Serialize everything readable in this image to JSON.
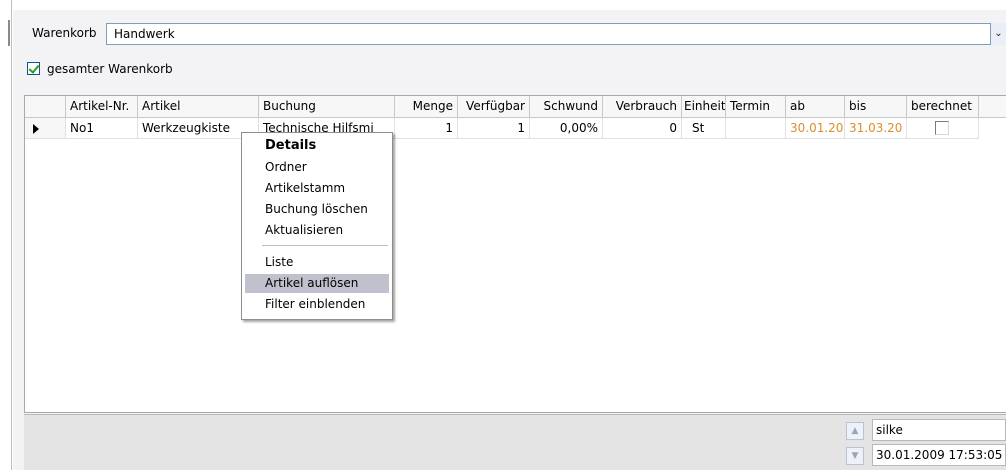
{
  "basket": {
    "label": "Warenkorb",
    "selected": "Handwerk",
    "dropdown_glyph": "⌄"
  },
  "checkbox": {
    "label": "gesamter Warenkorb",
    "checked": true
  },
  "grid": {
    "columns": [
      "Artikel-Nr.",
      "Artikel",
      "Buchung",
      "Menge",
      "Verfügbar",
      "Schwund",
      "Verbrauch",
      "Einheit",
      "Termin",
      "ab",
      "bis",
      "berechnet"
    ],
    "rows": [
      {
        "artikel_nr": "No1",
        "artikel": "Werkzeugkiste",
        "buchung": "Technische Hilfsmi",
        "menge": "1",
        "verfuegbar": "1",
        "schwund": "0,00%",
        "verbrauch": "0",
        "einheit": "St",
        "termin": "",
        "ab": "30.01.20",
        "bis": "31.03.20",
        "berechnet": false
      }
    ]
  },
  "context_menu": {
    "items": [
      "Details",
      "Ordner",
      "Artikelstamm",
      "Buchung löschen",
      "Aktualisieren",
      "Liste",
      "Artikel auflösen",
      "Filter einblenden"
    ],
    "highlighted": "Artikel auflösen"
  },
  "status": {
    "user": "silke",
    "timestamp": "30.01.2009 17:53:05"
  },
  "colors": {
    "date_text": "#d8902c",
    "menu_highlight": "#c1c1ce",
    "check": "#21a121"
  }
}
